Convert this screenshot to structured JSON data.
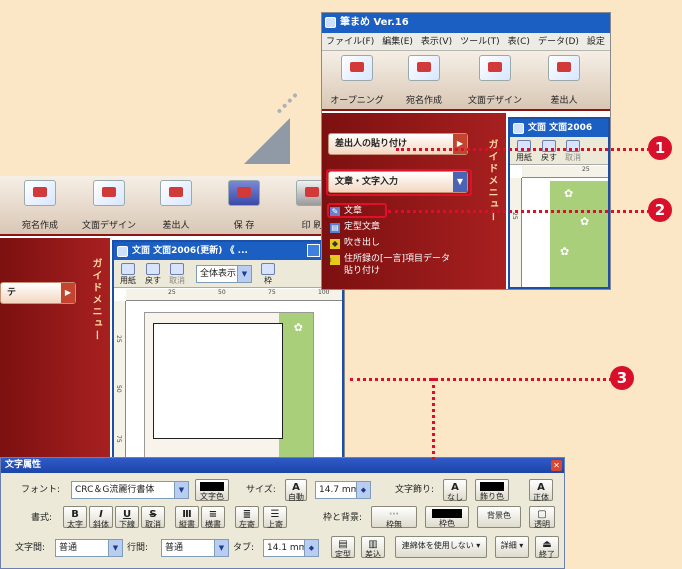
{
  "colors": {
    "accent_red": "#d8102a",
    "title_blue": "#1b5fc3",
    "guide_red": "#8b1515",
    "page_green": "#a9cf7a"
  },
  "app": {
    "title": "筆まめ Ver.16",
    "menu": [
      "ファイル(F)",
      "編集(E)",
      "表示(V)",
      "ツール(T)",
      "表(C)",
      "データ(D)",
      "設定"
    ],
    "toolbar_top": [
      "オープニング",
      "宛名作成",
      "文面デザイン",
      "差出人"
    ],
    "toolbar_back": [
      "宛名作成",
      "文面デザイン",
      "差出人",
      "保 存",
      "印 刷"
    ]
  },
  "guide_menu": {
    "vertical_label": "ガイドメニュー",
    "btn_sender_paste": "差出人の貼り付け",
    "btn_text_input": "文章・文字入力",
    "items": [
      "文章",
      "定型文章",
      "吹き出し",
      "住所録の[一言]項目データ貼り付け"
    ],
    "back_btn_label": "テ"
  },
  "doc_window": {
    "title_front": "文面   文面2006",
    "title_back": "文面   文面2006(更新) 《 ...",
    "tb_paper": "用紙",
    "tb_undo": "戻す",
    "tb_cancel": "取消",
    "view_select": "全体表示",
    "tb_frame": "枠",
    "ruler_marks": [
      "25",
      "50",
      "75",
      "100"
    ],
    "vruler_marks": [
      "25",
      "50",
      "75",
      "100"
    ]
  },
  "text_panel": {
    "title": "文字属性",
    "font_label": "フォント:",
    "font_value": "CRC＆G流麗行書体",
    "font_color": "文字色",
    "size_label": "サイズ:",
    "size_auto": "自動",
    "size_value": "14.7 mm",
    "deco_label": "文字飾り:",
    "deco_none": "なし",
    "deco_color": "飾り色",
    "upright": "正体",
    "style_label": "書式:",
    "bold": "太字",
    "italic": "斜体",
    "underline": "下線",
    "strike": "取消",
    "vertical": "縦書",
    "horizontal": "横書",
    "align_left": "左寄",
    "align_top": "上寄",
    "frame_bg_label": "枠と背景:",
    "frame_none": "枠無",
    "frame_color": "枠色",
    "bg_color": "背景色",
    "transparent": "透明",
    "char_spacing_label": "文字間:",
    "char_spacing_value": "普通",
    "line_spacing_label": "行間:",
    "line_spacing_value": "普通",
    "tab_label": "タブ:",
    "tab_value": "14.1 mm",
    "fixed": "定型",
    "insert": "差込",
    "cursive": "連綿体を使用しない",
    "detail": "詳細",
    "finish": "終了"
  },
  "callouts": [
    "1",
    "2",
    "3"
  ]
}
